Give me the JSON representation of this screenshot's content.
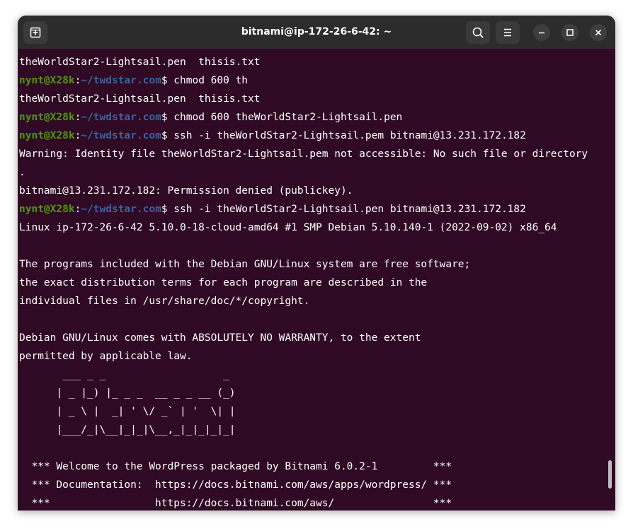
{
  "window": {
    "title": "bitnami@ip-172-26-6-42: ~"
  },
  "titlebar": {
    "new_tab_icon": "new-tab-icon",
    "search_icon": "search-icon",
    "menu_icon": "hamburger-menu-icon",
    "minimize_icon": "minimize-icon",
    "maximize_icon": "maximize-icon",
    "close_icon": "close-icon"
  },
  "colors": {
    "terminal_bg": "#300a24",
    "prompt_user": "#4e9a06",
    "prompt_path": "#3465a4",
    "text": "#ffffff"
  },
  "terminal": {
    "lines": [
      {
        "kind": "out",
        "text": "theWorldStar2-Lightsail.pen  thisis.txt"
      },
      {
        "kind": "cmd",
        "user": "nynt@X28k",
        "sep": ":",
        "path": "~/twdstar.com",
        "dollar": "$ ",
        "cmd": "chmod 600 th"
      },
      {
        "kind": "out",
        "text": "theWorldStar2-Lightsail.pen  thisis.txt"
      },
      {
        "kind": "cmd",
        "user": "nynt@X28k",
        "sep": ":",
        "path": "~/twdstar.com",
        "dollar": "$ ",
        "cmd": "chmod 600 theWorldStar2-Lightsail.pen"
      },
      {
        "kind": "cmd",
        "user": "nynt@X28k",
        "sep": ":",
        "path": "~/twdstar.com",
        "dollar": "$ ",
        "cmd": "ssh -i theWorldStar2-Lightsail.pem bitnami@13.231.172.182"
      },
      {
        "kind": "out",
        "text": "Warning: Identity file theWorldStar2-Lightsail.pem not accessible: No such file or directory"
      },
      {
        "kind": "out",
        "text": "."
      },
      {
        "kind": "out",
        "text": "bitnami@13.231.172.182: Permission denied (publickey)."
      },
      {
        "kind": "cmd",
        "user": "nynt@X28k",
        "sep": ":",
        "path": "~/twdstar.com",
        "dollar": "$ ",
        "cmd": "ssh -i theWorldStar2-Lightsail.pen bitnami@13.231.172.182"
      },
      {
        "kind": "out",
        "text": "Linux ip-172-26-6-42 5.10.0-18-cloud-amd64 #1 SMP Debian 5.10.140-1 (2022-09-02) x86_64"
      },
      {
        "kind": "out",
        "text": ""
      },
      {
        "kind": "out",
        "text": "The programs included with the Debian GNU/Linux system are free software;"
      },
      {
        "kind": "out",
        "text": "the exact distribution terms for each program are described in the"
      },
      {
        "kind": "out",
        "text": "individual files in /usr/share/doc/*/copyright."
      },
      {
        "kind": "out",
        "text": ""
      },
      {
        "kind": "out",
        "text": "Debian GNU/Linux comes with ABSOLUTELY NO WARRANTY, to the extent"
      },
      {
        "kind": "out",
        "text": "permitted by applicable law."
      },
      {
        "kind": "out",
        "text": "       ___ _ _                   _"
      },
      {
        "kind": "out",
        "text": "      | _ |_) |_ _ _  __ _ _ __ (_)"
      },
      {
        "kind": "out",
        "text": "      | _ \\ |  _| ' \\/ _` | '  \\| |"
      },
      {
        "kind": "out",
        "text": "      |___/_|\\__|_|_|\\__,_|_|_|_|_|"
      },
      {
        "kind": "out",
        "text": ""
      },
      {
        "kind": "out",
        "text": "  *** Welcome to the WordPress packaged by Bitnami 6.0.2-1         ***"
      },
      {
        "kind": "out",
        "text": "  *** Documentation:  https://docs.bitnami.com/aws/apps/wordpress/ ***"
      },
      {
        "kind": "out",
        "text": "  ***                 https://docs.bitnami.com/aws/                ***"
      }
    ]
  }
}
